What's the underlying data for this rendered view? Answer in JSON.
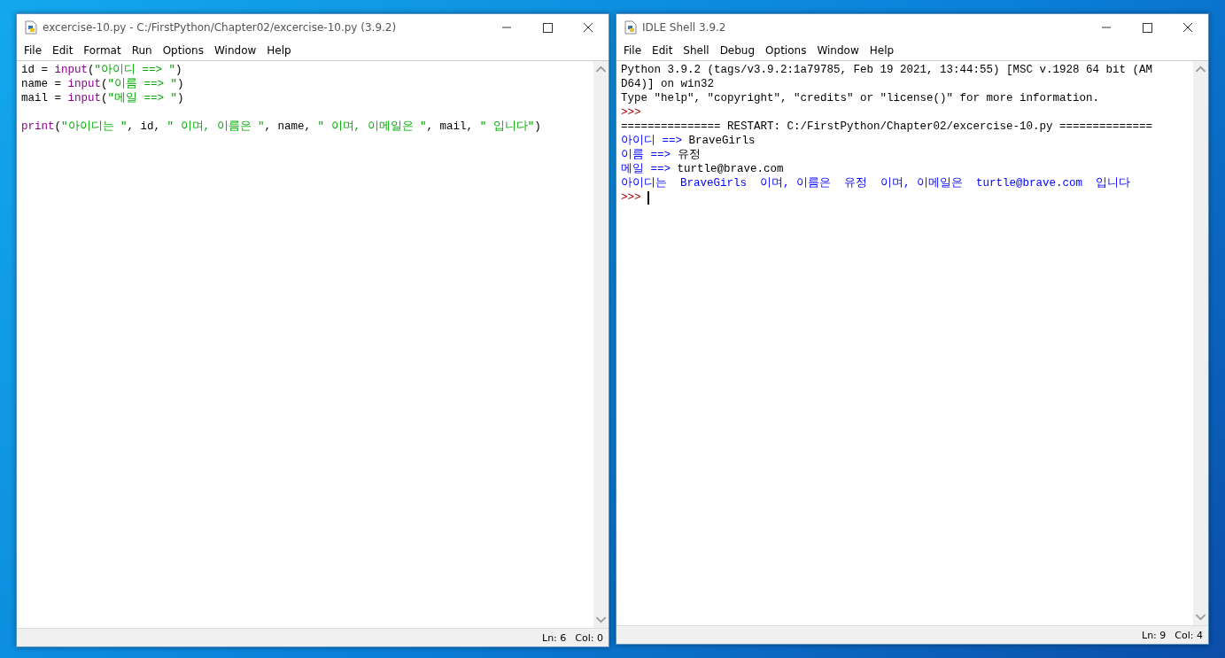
{
  "windows": [
    {
      "title": "excercise-10.py - C:/FirstPython/Chapter02/excercise-10.py (3.9.2)",
      "menu": [
        "File",
        "Edit",
        "Format",
        "Run",
        "Options",
        "Window",
        "Help"
      ],
      "lines": [
        [
          {
            "kind": "plain",
            "text": "id = "
          },
          {
            "kind": "builtin",
            "text": "input"
          },
          {
            "kind": "plain",
            "text": "("
          },
          {
            "kind": "string",
            "text": "\"아이디 ==> \""
          },
          {
            "kind": "plain",
            "text": ")"
          }
        ],
        [
          {
            "kind": "plain",
            "text": "name = "
          },
          {
            "kind": "builtin",
            "text": "input"
          },
          {
            "kind": "plain",
            "text": "("
          },
          {
            "kind": "string",
            "text": "\"이름 ==> \""
          },
          {
            "kind": "plain",
            "text": ")"
          }
        ],
        [
          {
            "kind": "plain",
            "text": "mail = "
          },
          {
            "kind": "builtin",
            "text": "input"
          },
          {
            "kind": "plain",
            "text": "("
          },
          {
            "kind": "string",
            "text": "\"메일 ==> \""
          },
          {
            "kind": "plain",
            "text": ")"
          }
        ],
        [
          {
            "kind": "blank"
          }
        ],
        [
          {
            "kind": "builtin",
            "text": "print"
          },
          {
            "kind": "plain",
            "text": "("
          },
          {
            "kind": "string",
            "text": "\"아이디는 \""
          },
          {
            "kind": "plain",
            "text": ", id, "
          },
          {
            "kind": "string",
            "text": "\" 이며, 이름은 \""
          },
          {
            "kind": "plain",
            "text": ", name, "
          },
          {
            "kind": "string",
            "text": "\" 이며, 이메일은 \""
          },
          {
            "kind": "plain",
            "text": ", mail, "
          },
          {
            "kind": "string",
            "text": "\" 입니다\""
          },
          {
            "kind": "plain",
            "text": ")"
          }
        ]
      ],
      "status": {
        "ln": "Ln: 6",
        "col": "Col: 0"
      }
    },
    {
      "title": "IDLE Shell 3.9.2",
      "menu": [
        "File",
        "Edit",
        "Shell",
        "Debug",
        "Options",
        "Window",
        "Help"
      ],
      "lines": [
        [
          {
            "kind": "plain",
            "text": "Python 3.9.2 (tags/v3.9.2:1a79785, Feb 19 2021, 13:44:55) [MSC v.1928 64 bit (AM"
          }
        ],
        [
          {
            "kind": "plain",
            "text": "D64)] on win32"
          }
        ],
        [
          {
            "kind": "plain",
            "text": "Type \"help\", \"copyright\", \"credits\" or \"license()\" for more information."
          }
        ],
        [
          {
            "kind": "prompt",
            "text": ">>> "
          }
        ],
        [
          {
            "kind": "plain",
            "text": "=============== RESTART: C:/FirstPython/Chapter02/excercise-10.py =============="
          }
        ],
        [
          {
            "kind": "stdout",
            "text": "아이디 ==> "
          },
          {
            "kind": "plain",
            "text": "BraveGirls"
          }
        ],
        [
          {
            "kind": "stdout",
            "text": "이름 ==> "
          },
          {
            "kind": "plain",
            "text": "유정"
          }
        ],
        [
          {
            "kind": "stdout",
            "text": "메일 ==> "
          },
          {
            "kind": "plain",
            "text": "turtle@brave.com"
          }
        ],
        [
          {
            "kind": "stdout",
            "text": "아이디는  BraveGirls  이며, 이름은  유정  이며, 이메일은  turtle@brave.com  입니다"
          }
        ],
        [
          {
            "kind": "prompt",
            "text": ">>> "
          }
        ]
      ],
      "cursor": true,
      "status": {
        "ln": "Ln: 9",
        "col": "Col: 4"
      }
    }
  ]
}
